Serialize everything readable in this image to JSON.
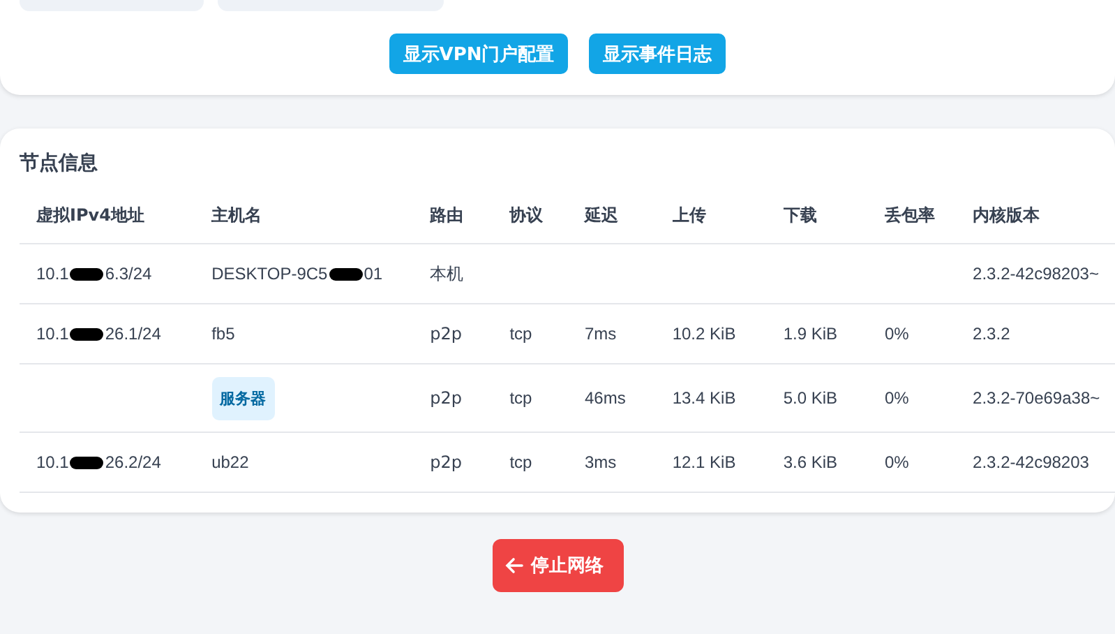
{
  "top_card": {
    "chips": [
      {
        "kind": "chip"
      },
      {
        "kind": "chip"
      }
    ],
    "buttons": [
      {
        "label": "显示VPN门户配置"
      },
      {
        "label": "显示事件日志"
      }
    ]
  },
  "nodes": {
    "title": "节点信息",
    "columns": [
      "虚拟IPv4地址",
      "主机名",
      "路由",
      "协议",
      "延迟",
      "上传",
      "下载",
      "丢包率",
      "内核版本"
    ],
    "rows": [
      {
        "ip": {
          "prefix": "10.1",
          "suffix": "6.3/24",
          "redacted": true
        },
        "host": {
          "kind": "redacted",
          "prefix": "DESKTOP-9C5",
          "suffix": "01"
        },
        "route": "本机",
        "protocol": "",
        "latency": "",
        "upload": "",
        "download": "",
        "loss": "",
        "version": "2.3.2-42c98203~"
      },
      {
        "ip": {
          "prefix": "10.1",
          "suffix": "26.1/24",
          "redacted": true
        },
        "host": {
          "kind": "text",
          "text": "fb5"
        },
        "route": "p2p",
        "protocol": "tcp",
        "latency": "7ms",
        "upload": "10.2 KiB",
        "download": "1.9 KiB",
        "loss": "0%",
        "version": "2.3.2"
      },
      {
        "host": {
          "kind": "badge",
          "text": "服务器"
        },
        "route": "p2p",
        "protocol": "tcp",
        "latency": "46ms",
        "upload": "13.4 KiB",
        "download": "5.0 KiB",
        "loss": "0%",
        "version": "2.3.2-70e69a38~"
      },
      {
        "ip": {
          "prefix": "10.1",
          "suffix": "26.2/24",
          "redacted": true
        },
        "host": {
          "kind": "text",
          "text": "ub22"
        },
        "route": "p2p",
        "protocol": "tcp",
        "latency": "3ms",
        "upload": "12.1 KiB",
        "download": "3.6 KiB",
        "loss": "0%",
        "version": "2.3.2-42c98203"
      }
    ]
  },
  "stop_button": {
    "label": "停止网络"
  }
}
